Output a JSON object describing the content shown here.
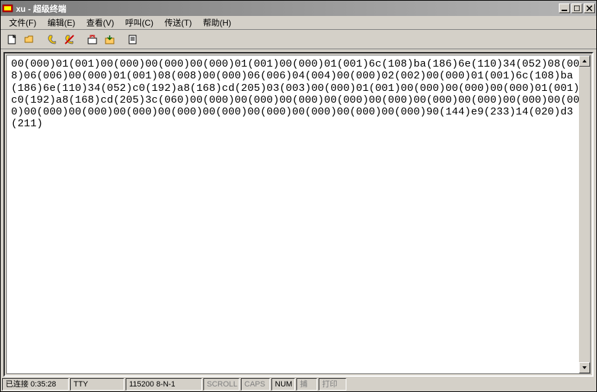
{
  "window": {
    "title": "xu - 超级终端"
  },
  "menu": {
    "file": "文件(F)",
    "edit": "编辑(E)",
    "view": "查看(V)",
    "call": "呼叫(C)",
    "transfer": "传送(T)",
    "help": "帮助(H)"
  },
  "toolbar_icons": {
    "new": "new-file-icon",
    "open": "open-folder-icon",
    "connect": "phone-connect-icon",
    "disconnect": "phone-disconnect-icon",
    "send": "send-icon",
    "receive": "receive-icon",
    "properties": "properties-icon"
  },
  "terminal": {
    "content": "00(000)01(001)00(000)00(000)00(000)01(001)00(000)01(001)6c(108)ba(186)6e(110)34(052)08(008)06(006)00(000)01(001)08(008)00(000)06(006)04(004)00(000)02(002)00(000)01(001)6c(108)ba(186)6e(110)34(052)c0(192)a8(168)cd(205)03(003)00(000)01(001)00(000)00(000)00(000)01(001)c0(192)a8(168)cd(205)3c(060)00(000)00(000)00(000)00(000)00(000)00(000)00(000)00(000)00(000)00(000)00(000)00(000)00(000)00(000)00(000)00(000)00(000)00(000)90(144)e9(233)14(020)d3(211)"
  },
  "status": {
    "connected": "已连接 0:35:28",
    "tty": "TTY",
    "port": "115200 8-N-1",
    "scroll": "SCROLL",
    "caps": "CAPS",
    "num": "NUM",
    "capture": "捕",
    "print": "打印"
  }
}
